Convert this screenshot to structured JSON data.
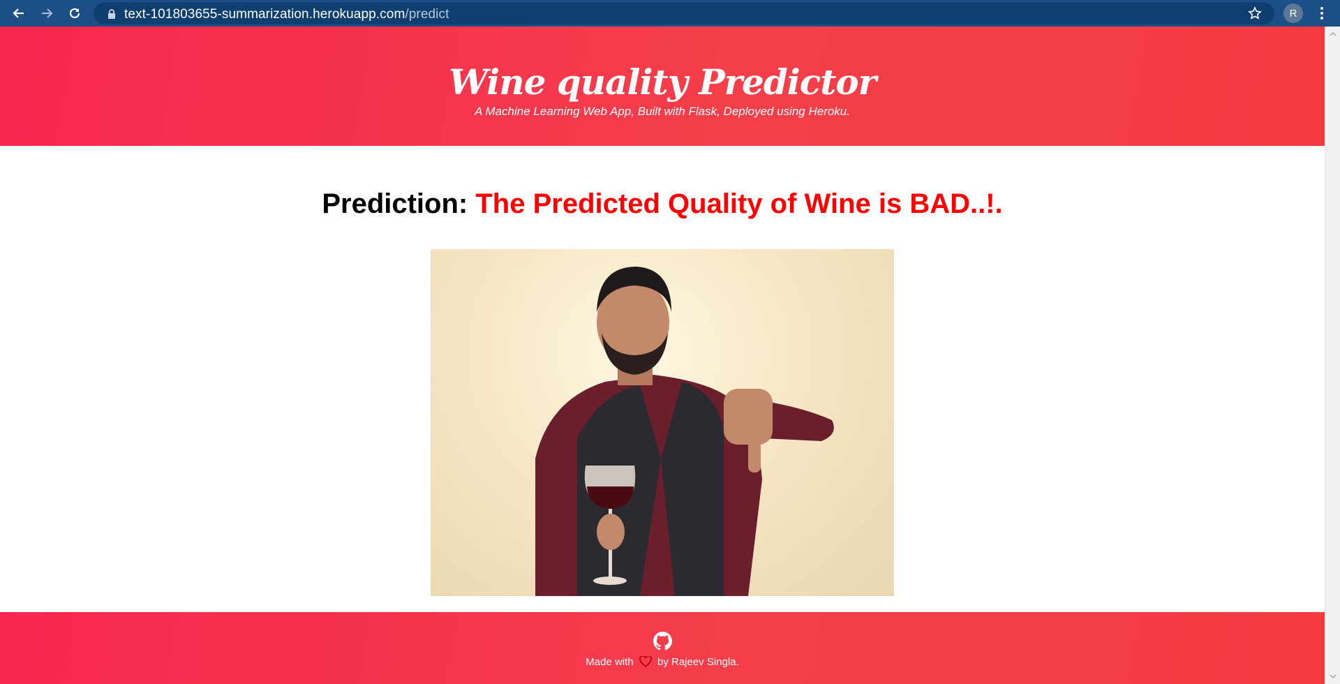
{
  "browser": {
    "url_host": "text-101803655-summarization.herokuapp.com",
    "url_path": "/predict",
    "profile_initial": "R"
  },
  "header": {
    "title": "Wine quality Predictor",
    "subtitle": "A Machine Learning Web App, Built with Flask, Deployed using Heroku."
  },
  "prediction": {
    "label": "Prediction:",
    "result": "The Predicted Quality of Wine is BAD..!."
  },
  "footer": {
    "made_with": "Made with",
    "by": "by Rajeev Singla."
  },
  "colors": {
    "accent": "#f53e4a",
    "result_text": "#ff0000",
    "browser_bar": "#1b4f86"
  }
}
